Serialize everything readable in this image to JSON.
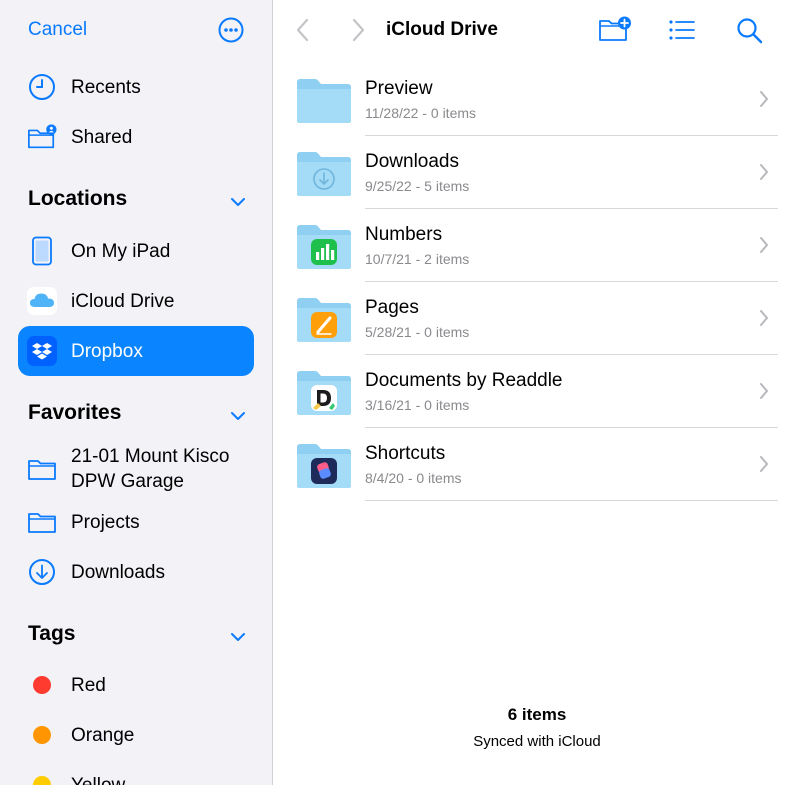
{
  "sidebar": {
    "cancel_label": "Cancel",
    "more_icon": "ellipsis-circle-icon",
    "top_items": [
      {
        "label": "Recents",
        "icon": "clock-icon"
      },
      {
        "label": "Shared",
        "icon": "shared-folder-icon"
      }
    ],
    "locations": {
      "title": "Locations",
      "items": [
        {
          "label": "On My iPad",
          "icon": "ipad-icon"
        },
        {
          "label": "iCloud Drive",
          "icon": "icloud-icon"
        },
        {
          "label": "Dropbox",
          "icon": "dropbox-icon",
          "selected": true
        }
      ]
    },
    "favorites": {
      "title": "Favorites",
      "items": [
        {
          "label": "21-01 Mount Kisco DPW Garage",
          "icon": "folder-icon"
        },
        {
          "label": "Projects",
          "icon": "folder-icon"
        },
        {
          "label": "Downloads",
          "icon": "download-circle-icon"
        }
      ]
    },
    "tags": {
      "title": "Tags",
      "items": [
        {
          "label": "Red",
          "color": "#ff3b30"
        },
        {
          "label": "Orange",
          "color": "#ff9500"
        },
        {
          "label": "Yellow",
          "color": "#ffcc00"
        }
      ]
    }
  },
  "toolbar": {
    "title": "iCloud Drive",
    "back_icon": "chevron-left-icon",
    "forward_icon": "chevron-right-icon",
    "new_folder_icon": "new-folder-icon",
    "list_view_icon": "list-icon",
    "search_icon": "search-icon"
  },
  "files": [
    {
      "name": "Preview",
      "meta": "11/28/22 - 0 items",
      "badge": "none"
    },
    {
      "name": "Downloads",
      "meta": "9/25/22 - 5 items",
      "badge": "download"
    },
    {
      "name": "Numbers",
      "meta": "10/7/21 - 2 items",
      "badge": "numbers"
    },
    {
      "name": "Pages",
      "meta": "5/28/21 - 0 items",
      "badge": "pages"
    },
    {
      "name": "Documents by Readdle",
      "meta": "3/16/21 - 0 items",
      "badge": "readdle"
    },
    {
      "name": "Shortcuts",
      "meta": "8/4/20 - 0 items",
      "badge": "shortcuts"
    }
  ],
  "footer": {
    "count": "6 items",
    "sync": "Synced with iCloud"
  },
  "colors": {
    "accent": "#0a7aff",
    "selected_bg": "#0a84ff",
    "folder": "#8fd0f2",
    "sidebar_bg": "#f2f2f7"
  }
}
